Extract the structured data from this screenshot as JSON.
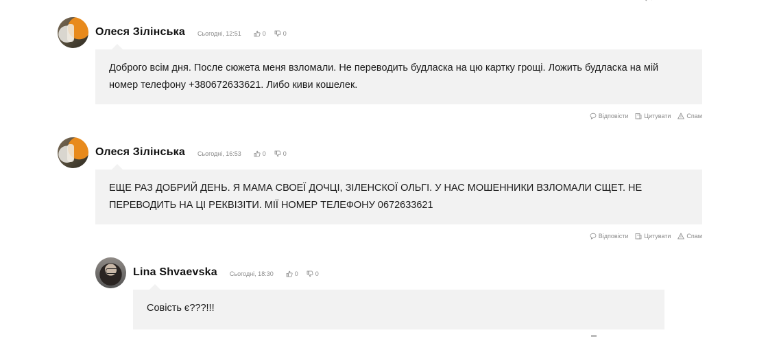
{
  "comments": [
    {
      "author": "Олеся Зілінська",
      "time": "Сьогодні, 12:51",
      "likes": "0",
      "dislikes": "0",
      "text": "Доброго всім дня. После сюжета меня взломали. Не переводить будласка на цю картку грощі. Ложить будласка на мій номер телефону +380672633621. Либо киви кошелек.",
      "actions": {
        "reply": "Відповісти",
        "quote": "Цитувати",
        "spam": "Спам"
      }
    },
    {
      "author": "Олеся Зілінська",
      "time": "Сьогодні, 16:53",
      "likes": "0",
      "dislikes": "0",
      "text": "ЕЩЕ РАЗ ДОБРИЙ ДЕНЬ. Я МАМА СВОЕЇ ДОЧЦІ, ЗІЛЕНСКОЇ ОЛЬГІ. У НАС МОШЕННИКИ ВЗЛОМАЛИ СЩЕТ. НЕ ПЕРЕВОДИТЬ НА ЦІ РЕКВІЗІТИ. МІЇ НОМЕР ТЕЛЕФОНУ 0672633621",
      "actions": {
        "reply": "Відповісти",
        "quote": "Цитувати",
        "spam": "Спам"
      }
    },
    {
      "author": "Lina Shvaevska",
      "time": "Сьогодні, 18:30",
      "likes": "0",
      "dislikes": "0",
      "text": "Совість є???!!!"
    }
  ],
  "icons": {
    "like": "thumbs-up-icon",
    "dislike": "thumbs-down-icon",
    "reply": "speech-bubble-icon",
    "quote": "quote-icon",
    "spam": "warning-icon"
  },
  "colors": {
    "body_bg": "#f2f2f2",
    "meta": "#8a8a8a",
    "author": "#111111"
  }
}
